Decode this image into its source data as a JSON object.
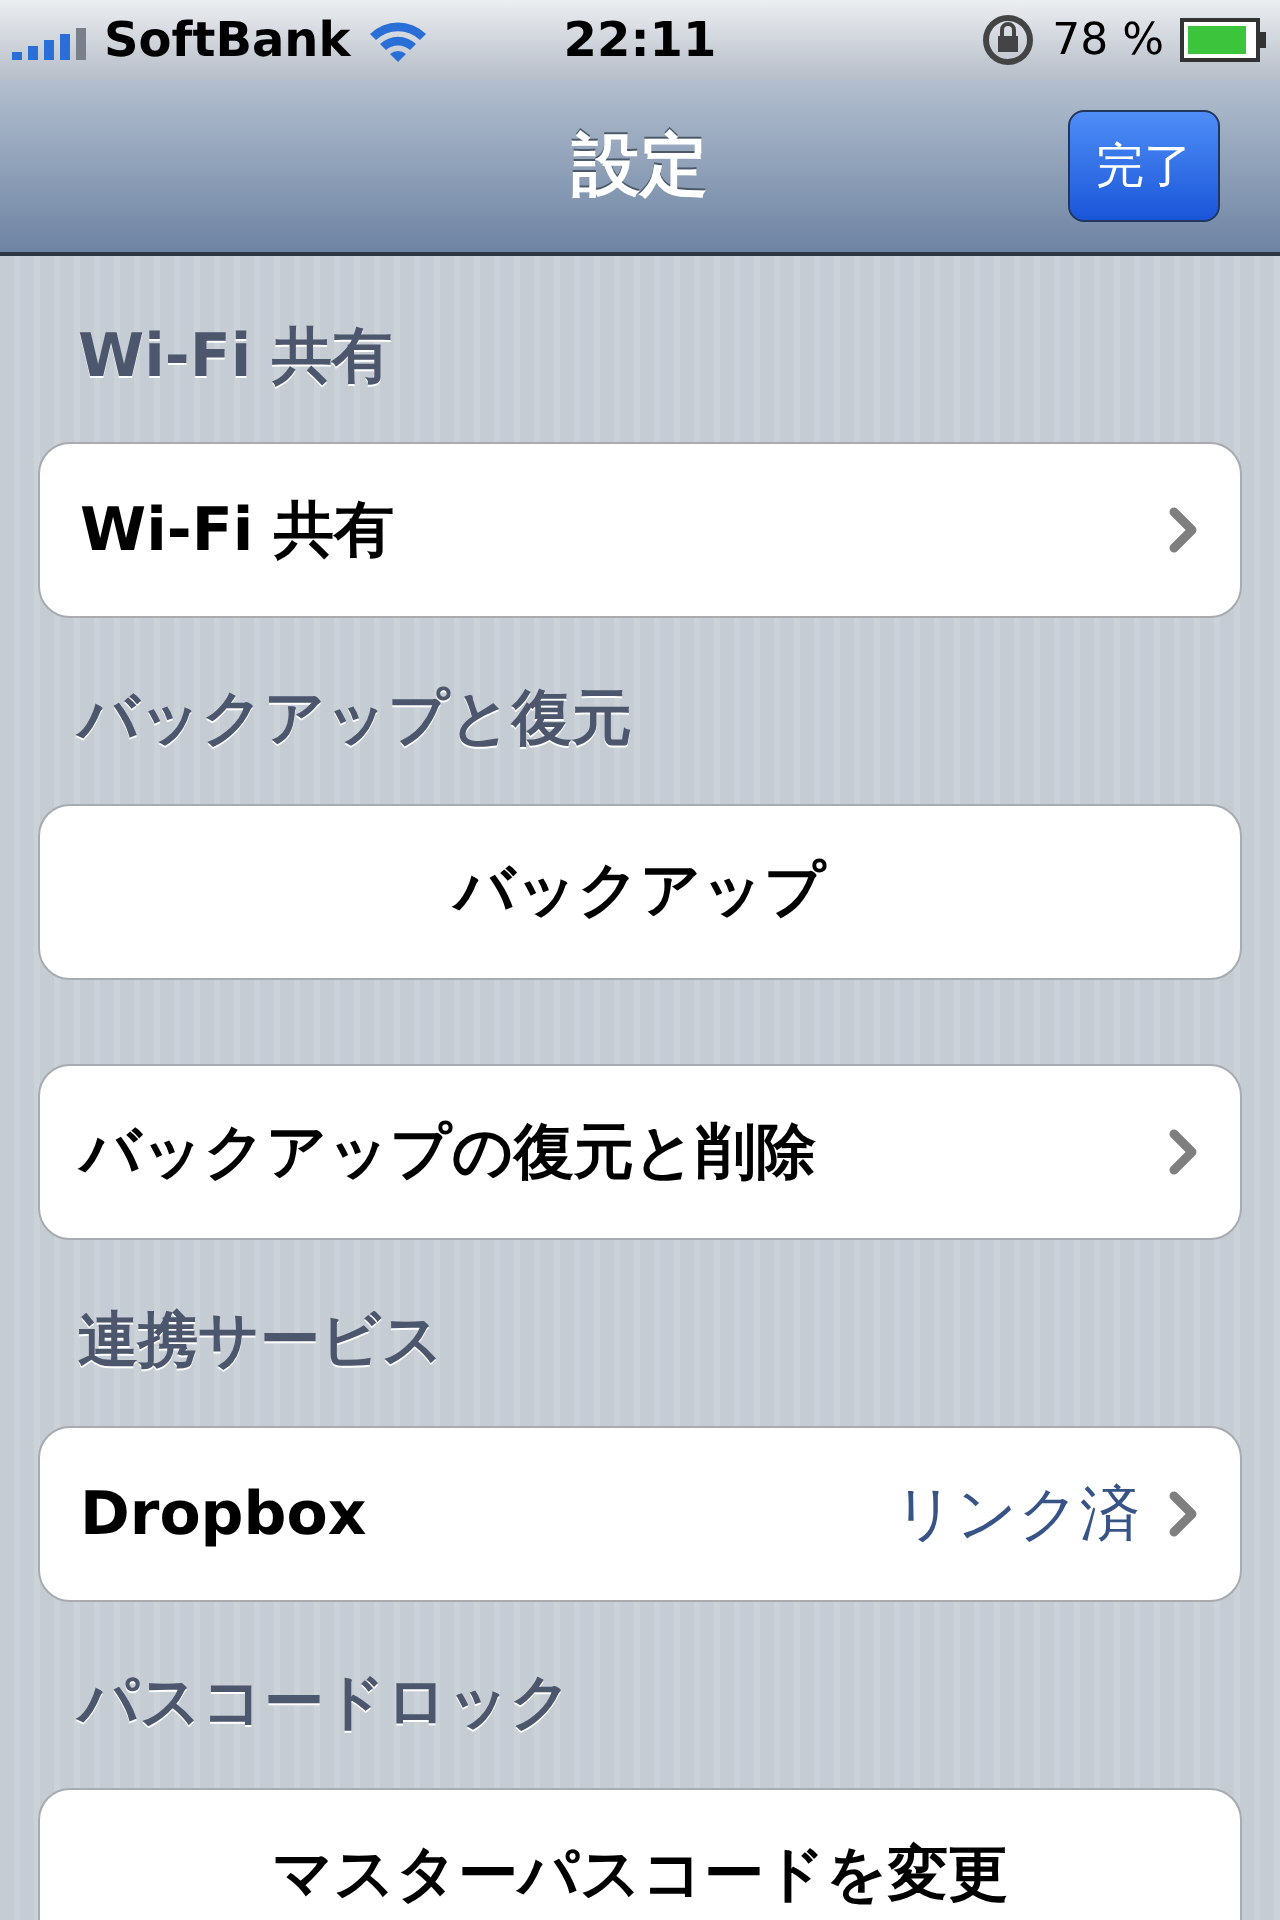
{
  "status_bar": {
    "carrier": "SoftBank",
    "time": "22:11",
    "battery": "78 %"
  },
  "nav_bar": {
    "title": "設定",
    "done_button": "完了"
  },
  "sections": [
    {
      "header": "Wi-Fi 共有",
      "cells": [
        {
          "kind": "disclosure",
          "label": "Wi-Fi 共有"
        }
      ]
    },
    {
      "header": "バックアップと復元",
      "cells": [
        {
          "kind": "button",
          "label": "バックアップ"
        }
      ]
    },
    {
      "cells": [
        {
          "kind": "disclosure",
          "label": "バックアップの復元と削除"
        }
      ]
    },
    {
      "header": "連携サービス",
      "cells": [
        {
          "kind": "disclosure",
          "label": "Dropbox",
          "detail": "リンク済"
        }
      ]
    },
    {
      "header": "パスコードロック",
      "cells": [
        {
          "kind": "button",
          "label": "マスターパスコードを変更"
        }
      ]
    }
  ]
}
